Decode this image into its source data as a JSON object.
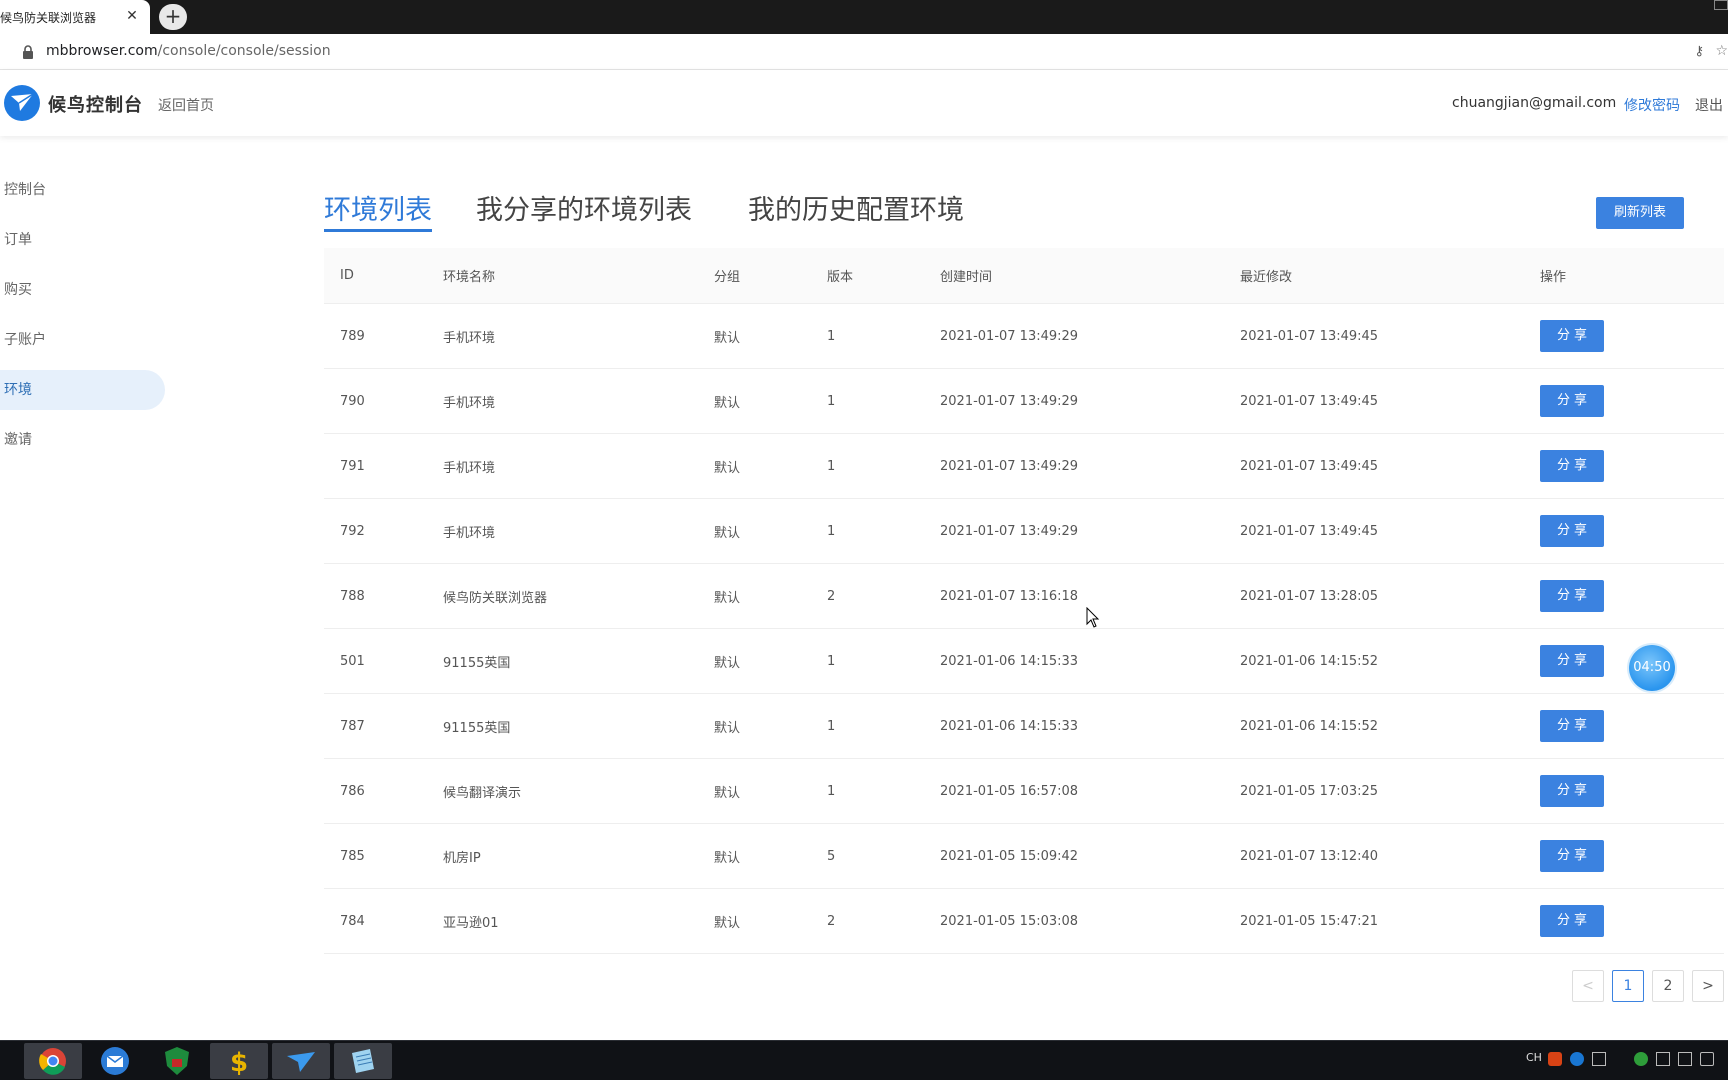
{
  "browser": {
    "tab_title": "候鸟防关联浏览器",
    "close_glyph": "✕",
    "new_tab_glyph": "+",
    "url_host": "mbbrowser.com",
    "url_path": "/console/console/session",
    "key_icon": "key-icon",
    "star_icon": "star-icon"
  },
  "header": {
    "brand": "候鸟控制台",
    "back_home": "返回首页",
    "email": "chuangjian@gmail.com",
    "change_password": "修改密码",
    "logout": "退出"
  },
  "sidebar": {
    "items": [
      {
        "label": "控制台",
        "active": false
      },
      {
        "label": "订单",
        "active": false
      },
      {
        "label": "购买",
        "active": false
      },
      {
        "label": "子账户",
        "active": false
      },
      {
        "label": "环境",
        "active": true
      },
      {
        "label": "邀请",
        "active": false
      }
    ]
  },
  "main": {
    "tabs": [
      {
        "label": "环境列表",
        "active": true
      },
      {
        "label": "我分享的环境列表",
        "active": false
      },
      {
        "label": "我的历史配置环境",
        "active": false
      }
    ],
    "refresh_label": "刷新列表",
    "columns": [
      "ID",
      "环境名称",
      "分组",
      "版本",
      "创建时间",
      "最近修改",
      "操作"
    ],
    "rows": [
      {
        "id": "789",
        "name": "手机环境",
        "group": "默认",
        "version": "1",
        "created": "2021-01-07 13:49:29",
        "modified": "2021-01-07 13:49:45",
        "action": "分享"
      },
      {
        "id": "790",
        "name": "手机环境",
        "group": "默认",
        "version": "1",
        "created": "2021-01-07 13:49:29",
        "modified": "2021-01-07 13:49:45",
        "action": "分享"
      },
      {
        "id": "791",
        "name": "手机环境",
        "group": "默认",
        "version": "1",
        "created": "2021-01-07 13:49:29",
        "modified": "2021-01-07 13:49:45",
        "action": "分享"
      },
      {
        "id": "792",
        "name": "手机环境",
        "group": "默认",
        "version": "1",
        "created": "2021-01-07 13:49:29",
        "modified": "2021-01-07 13:49:45",
        "action": "分享"
      },
      {
        "id": "788",
        "name": "候鸟防关联浏览器",
        "group": "默认",
        "version": "2",
        "created": "2021-01-07 13:16:18",
        "modified": "2021-01-07 13:28:05",
        "action": "分享"
      },
      {
        "id": "501",
        "name": "91155英国",
        "group": "默认",
        "version": "1",
        "created": "2021-01-06 14:15:33",
        "modified": "2021-01-06 14:15:52",
        "action": "分享"
      },
      {
        "id": "787",
        "name": "91155英国",
        "group": "默认",
        "version": "1",
        "created": "2021-01-06 14:15:33",
        "modified": "2021-01-06 14:15:52",
        "action": "分享"
      },
      {
        "id": "786",
        "name": "候鸟翻译演示",
        "group": "默认",
        "version": "1",
        "created": "2021-01-05 16:57:08",
        "modified": "2021-01-05 17:03:25",
        "action": "分享"
      },
      {
        "id": "785",
        "name": "机房IP",
        "group": "默认",
        "version": "5",
        "created": "2021-01-05 15:09:42",
        "modified": "2021-01-07 13:12:40",
        "action": "分享"
      },
      {
        "id": "784",
        "name": "亚马逊01",
        "group": "默认",
        "version": "2",
        "created": "2021-01-05 15:03:08",
        "modified": "2021-01-05 15:47:21",
        "action": "分享"
      }
    ]
  },
  "pagination": {
    "prev": "<",
    "pages": [
      "1",
      "2"
    ],
    "current": "1",
    "next": ">"
  },
  "timer": "04:50",
  "taskbar": {
    "apps": [
      "chrome-icon",
      "mail-icon",
      "shield-icon",
      "dollar-icon",
      "bird-icon",
      "notepad-icon"
    ],
    "tray_lang": "CH"
  },
  "colors": {
    "accent": "#3b82e0",
    "link": "#2f7ad8",
    "active_side_bg": "#e6f0fb"
  }
}
